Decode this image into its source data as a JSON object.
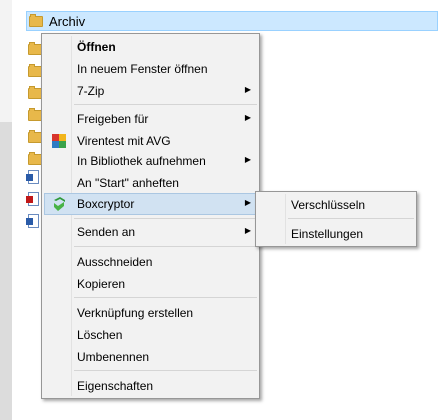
{
  "explorer": {
    "selected_item": "Archiv"
  },
  "context_menu": {
    "items": [
      {
        "label": "Öffnen"
      },
      {
        "label": "In neuem Fenster öffnen"
      },
      {
        "label": "7-Zip"
      },
      {
        "label": "Freigeben für"
      },
      {
        "label": "Virentest mit AVG"
      },
      {
        "label": "In Bibliothek aufnehmen"
      },
      {
        "label": "An \"Start\" anheften"
      },
      {
        "label": "Boxcryptor"
      },
      {
        "label": "Senden an"
      },
      {
        "label": "Ausschneiden"
      },
      {
        "label": "Kopieren"
      },
      {
        "label": "Verknüpfung erstellen"
      },
      {
        "label": "Löschen"
      },
      {
        "label": "Umbenennen"
      },
      {
        "label": "Eigenschaften"
      }
    ],
    "submenu_arrow": "▶"
  },
  "boxcryptor_submenu": {
    "items": [
      {
        "label": "Verschlüsseln"
      },
      {
        "label": "Einstellungen"
      }
    ]
  }
}
